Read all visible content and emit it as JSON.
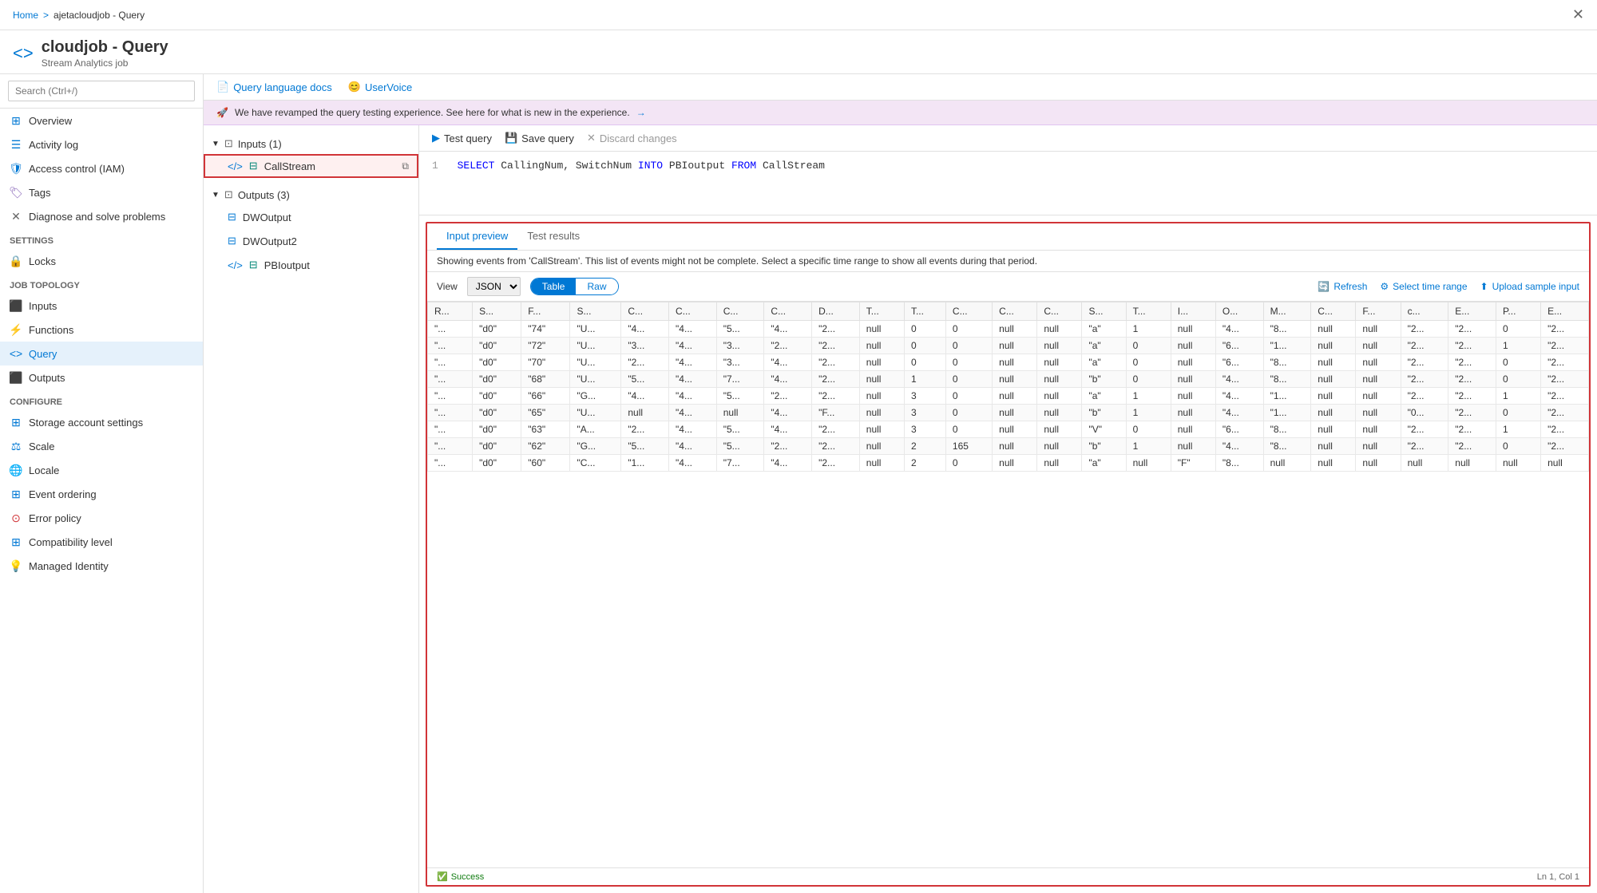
{
  "breadcrumb": {
    "home": "Home",
    "separator": ">",
    "current": "ajetacloudjob - Query"
  },
  "title": {
    "icon": "<>",
    "name": "cloudjob - Query",
    "subtitle": "Stream Analytics job"
  },
  "toolbar": {
    "docs_label": "Query language docs",
    "uservoice_label": "UserVoice"
  },
  "banner": {
    "text": "We have revamped the query testing experience. See here for what is new in the experience.",
    "arrow": "→"
  },
  "tree": {
    "inputs_label": "Inputs (1)",
    "input_item": "CallStream",
    "outputs_label": "Outputs (3)",
    "output_items": [
      "DWOutput",
      "DWOutput2",
      "PBIoutput"
    ]
  },
  "query_actions": {
    "test": "Test query",
    "save": "Save query",
    "discard": "Discard changes"
  },
  "query": {
    "line": "1",
    "code": "SELECT CallingNum, SwitchNum INTO PBIoutput FROM CallStream"
  },
  "results": {
    "tab_preview": "Input preview",
    "tab_test": "Test results",
    "info_text": "Showing events from 'CallStream'. This list of events might not be complete. Select a specific time range to show all events during that period.",
    "view_label": "View",
    "view_option": "JSON",
    "toggle_table": "Table",
    "toggle_raw": "Raw",
    "refresh_label": "Refresh",
    "time_range_label": "Select time range",
    "upload_label": "Upload sample input",
    "columns": [
      "R...",
      "S...",
      "F...",
      "S...",
      "C...",
      "C...",
      "C...",
      "C...",
      "D...",
      "T...",
      "T...",
      "C...",
      "C...",
      "C...",
      "S...",
      "T...",
      "I...",
      "O...",
      "M...",
      "C...",
      "F...",
      "c...",
      "E...",
      "P...",
      "E..."
    ],
    "rows": [
      [
        "\"...",
        "\"d0\"",
        "\"74\"",
        "\"U...",
        "\"4...",
        "\"4...",
        "\"5...",
        "\"4...",
        "\"2...",
        "null",
        "0",
        "0",
        "null",
        "null",
        "\"a\"",
        "1",
        "null",
        "\"4...",
        "\"8...",
        "null",
        "null",
        "\"2...",
        "\"2...",
        "0",
        "\"2..."
      ],
      [
        "\"...",
        "\"d0\"",
        "\"72\"",
        "\"U...",
        "\"3...",
        "\"4...",
        "\"3...",
        "\"2...",
        "\"2...",
        "null",
        "0",
        "0",
        "null",
        "null",
        "\"a\"",
        "0",
        "null",
        "\"6...",
        "\"1...",
        "null",
        "null",
        "\"2...",
        "\"2...",
        "1",
        "\"2..."
      ],
      [
        "\"...",
        "\"d0\"",
        "\"70\"",
        "\"U...",
        "\"2...",
        "\"4...",
        "\"3...",
        "\"4...",
        "\"2...",
        "null",
        "0",
        "0",
        "null",
        "null",
        "\"a\"",
        "0",
        "null",
        "\"6...",
        "\"8...",
        "null",
        "null",
        "\"2...",
        "\"2...",
        "0",
        "\"2..."
      ],
      [
        "\"...",
        "\"d0\"",
        "\"68\"",
        "\"U...",
        "\"5...",
        "\"4...",
        "\"7...",
        "\"4...",
        "\"2...",
        "null",
        "1",
        "0",
        "null",
        "null",
        "\"b\"",
        "0",
        "null",
        "\"4...",
        "\"8...",
        "null",
        "null",
        "\"2...",
        "\"2...",
        "0",
        "\"2..."
      ],
      [
        "\"...",
        "\"d0\"",
        "\"66\"",
        "\"G...",
        "\"4...",
        "\"4...",
        "\"5...",
        "\"2...",
        "\"2...",
        "null",
        "3",
        "0",
        "null",
        "null",
        "\"a\"",
        "1",
        "null",
        "\"4...",
        "\"1...",
        "null",
        "null",
        "\"2...",
        "\"2...",
        "1",
        "\"2..."
      ],
      [
        "\"...",
        "\"d0\"",
        "\"65\"",
        "\"U...",
        "null",
        "\"4...",
        "null",
        "\"4...",
        "\"F...",
        "null",
        "3",
        "0",
        "null",
        "null",
        "\"b\"",
        "1",
        "null",
        "\"4...",
        "\"1...",
        "null",
        "null",
        "\"0...",
        "\"2...",
        "0",
        "\"2..."
      ],
      [
        "\"...",
        "\"d0\"",
        "\"63\"",
        "\"A...",
        "\"2...",
        "\"4...",
        "\"5...",
        "\"4...",
        "\"2...",
        "null",
        "3",
        "0",
        "null",
        "null",
        "\"V\"",
        "0",
        "null",
        "\"6...",
        "\"8...",
        "null",
        "null",
        "\"2...",
        "\"2...",
        "1",
        "\"2..."
      ],
      [
        "\"...",
        "\"d0\"",
        "\"62\"",
        "\"G...",
        "\"5...",
        "\"4...",
        "\"5...",
        "\"2...",
        "\"2...",
        "null",
        "2",
        "165",
        "null",
        "null",
        "\"b\"",
        "1",
        "null",
        "\"4...",
        "\"8...",
        "null",
        "null",
        "\"2...",
        "\"2...",
        "0",
        "\"2..."
      ],
      [
        "\"...",
        "\"d0\"",
        "\"60\"",
        "\"C...",
        "\"1...",
        "\"4...",
        "\"7...",
        "\"4...",
        "\"2...",
        "null",
        "2",
        "0",
        "null",
        "null",
        "\"a\"",
        "null",
        "\"F\"",
        "\"8...",
        "null",
        "null",
        "null",
        "null",
        "null",
        "null",
        "null"
      ]
    ],
    "status": "Success",
    "position": "Ln 1, Col 1"
  },
  "sidebar": {
    "search_placeholder": "Search (Ctrl+/)",
    "items": [
      {
        "label": "Overview",
        "icon": "home",
        "color": "blue"
      },
      {
        "label": "Activity log",
        "icon": "list",
        "color": "blue"
      },
      {
        "label": "Access control (IAM)",
        "icon": "shield",
        "color": "blue"
      },
      {
        "label": "Tags",
        "icon": "tag",
        "color": "purple"
      },
      {
        "label": "Diagnose and solve problems",
        "icon": "wrench",
        "color": "gray"
      }
    ],
    "settings_header": "Settings",
    "settings_items": [
      {
        "label": "Locks",
        "icon": "lock",
        "color": "gray"
      }
    ],
    "job_topology_header": "Job topology",
    "job_topology_items": [
      {
        "label": "Inputs",
        "icon": "input",
        "color": "blue"
      },
      {
        "label": "Functions",
        "icon": "function",
        "color": "blue"
      },
      {
        "label": "Query",
        "icon": "query",
        "color": "blue",
        "active": true
      },
      {
        "label": "Outputs",
        "icon": "output",
        "color": "blue"
      }
    ],
    "configure_header": "Configure",
    "configure_items": [
      {
        "label": "Storage account settings",
        "icon": "storage",
        "color": "blue"
      },
      {
        "label": "Scale",
        "icon": "scale",
        "color": "blue"
      },
      {
        "label": "Locale",
        "icon": "locale",
        "color": "green"
      },
      {
        "label": "Event ordering",
        "icon": "event",
        "color": "blue"
      },
      {
        "label": "Error policy",
        "icon": "error",
        "color": "red"
      },
      {
        "label": "Compatibility level",
        "icon": "compat",
        "color": "blue"
      },
      {
        "label": "Managed Identity",
        "icon": "identity",
        "color": "yellow"
      }
    ]
  }
}
